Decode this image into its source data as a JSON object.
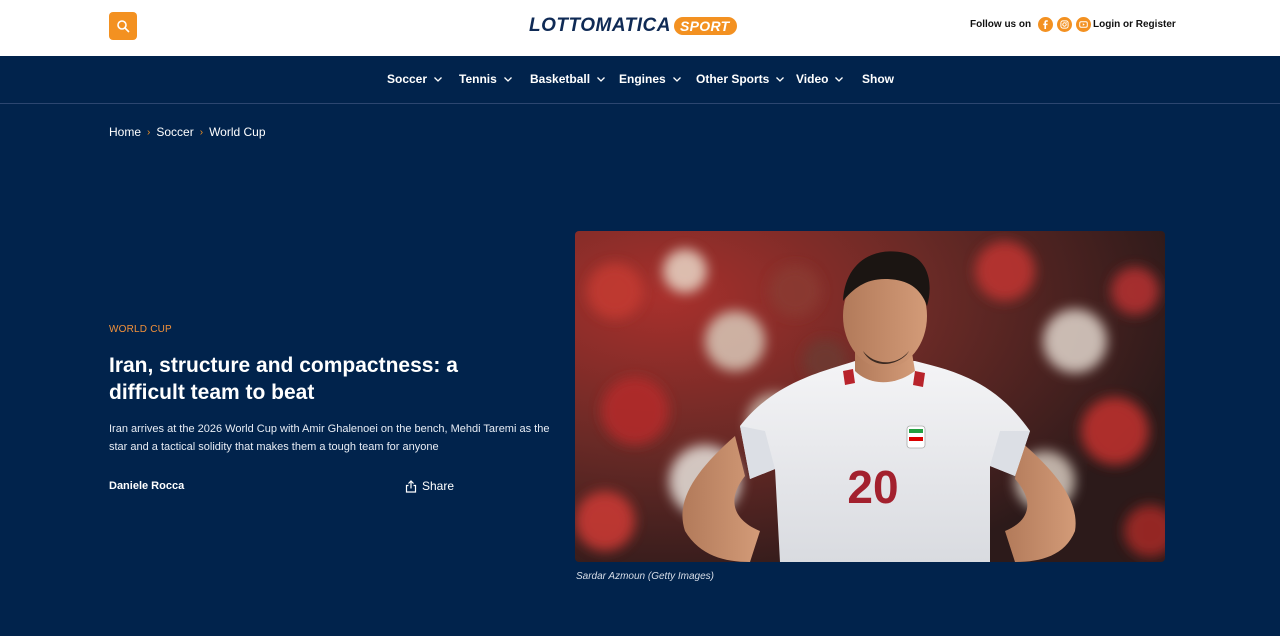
{
  "header": {
    "logo_main": "LOTTOMATICA",
    "logo_sport": "SPORT",
    "follow_label": "Follow us on",
    "login_label": "Login or Register",
    "social": [
      "facebook-icon",
      "instagram-icon",
      "youtube-icon"
    ],
    "accent_color": "#f39121"
  },
  "nav": {
    "items": [
      {
        "label": "Soccer"
      },
      {
        "label": "Tennis"
      },
      {
        "label": "Basketball"
      },
      {
        "label": "Engines"
      },
      {
        "label": "Other Sports"
      },
      {
        "label": "Video"
      },
      {
        "label": "Show"
      }
    ]
  },
  "breadcrumb": [
    "Home",
    "Soccer",
    "World Cup"
  ],
  "article": {
    "kicker": "WORLD CUP",
    "title": "Iran, structure and compactness: a difficult team to beat",
    "description": "Iran arrives at the 2026 World Cup with Amir Ghalenoei on the bench, Mehdi Taremi as the star and a tactical solidity that makes them a tough team for anyone",
    "author": "Daniele Rocca",
    "share_label": "Share",
    "image_caption": "Sardar Azmoun (Getty Images)",
    "jersey_number": "20"
  }
}
